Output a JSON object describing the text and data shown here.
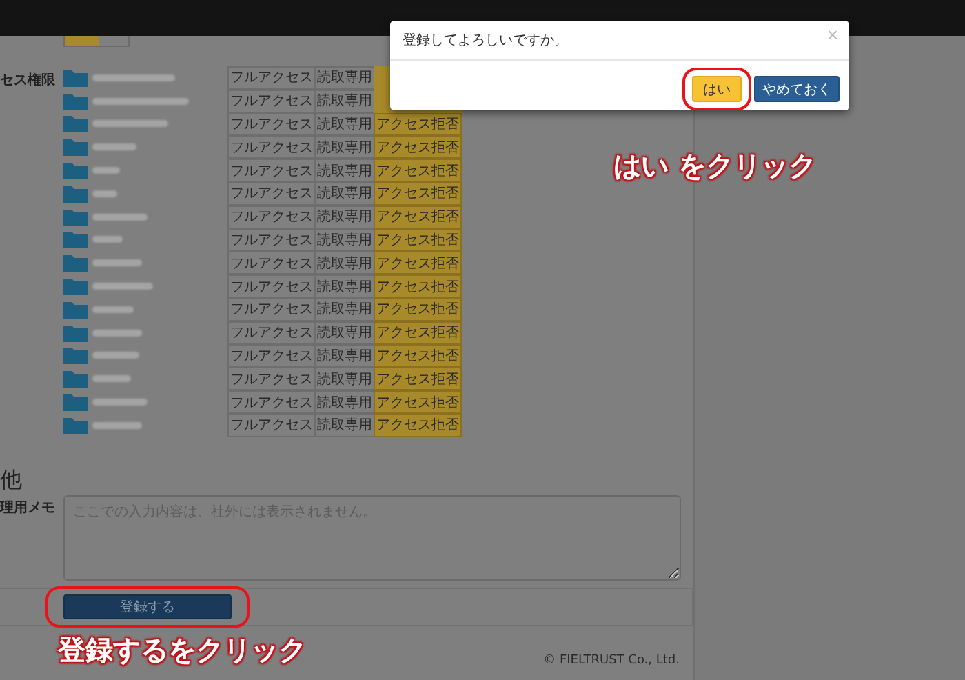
{
  "toggle": {
    "on": true
  },
  "permissions": {
    "label": "セス権限",
    "rows": [
      {
        "options": [
          {
            "label": "フルアクセス",
            "selected": false
          },
          {
            "label": "読取専用",
            "selected": false
          }
        ]
      },
      {
        "options": [
          {
            "label": "フルアクセス",
            "selected": false
          },
          {
            "label": "読取専用",
            "selected": false
          }
        ]
      },
      {
        "options": [
          {
            "label": "フルアクセス",
            "selected": false
          },
          {
            "label": "読取専用",
            "selected": false
          },
          {
            "label": "アクセス拒否",
            "selected": true
          }
        ]
      },
      {
        "options": [
          {
            "label": "フルアクセス",
            "selected": false
          },
          {
            "label": "読取専用",
            "selected": false
          },
          {
            "label": "アクセス拒否",
            "selected": true
          }
        ]
      },
      {
        "options": [
          {
            "label": "フルアクセス",
            "selected": false
          },
          {
            "label": "読取専用",
            "selected": false
          },
          {
            "label": "アクセス拒否",
            "selected": true
          }
        ]
      },
      {
        "options": [
          {
            "label": "フルアクセス",
            "selected": false
          },
          {
            "label": "読取専用",
            "selected": false
          },
          {
            "label": "アクセス拒否",
            "selected": true
          }
        ]
      },
      {
        "options": [
          {
            "label": "フルアクセス",
            "selected": false
          },
          {
            "label": "読取専用",
            "selected": false
          },
          {
            "label": "アクセス拒否",
            "selected": true
          }
        ]
      },
      {
        "options": [
          {
            "label": "フルアクセス",
            "selected": false
          },
          {
            "label": "読取専用",
            "selected": false
          },
          {
            "label": "アクセス拒否",
            "selected": true
          }
        ]
      },
      {
        "options": [
          {
            "label": "フルアクセス",
            "selected": false
          },
          {
            "label": "読取専用",
            "selected": false
          },
          {
            "label": "アクセス拒否",
            "selected": true
          }
        ]
      },
      {
        "options": [
          {
            "label": "フルアクセス",
            "selected": false
          },
          {
            "label": "読取専用",
            "selected": false
          },
          {
            "label": "アクセス拒否",
            "selected": true
          }
        ]
      },
      {
        "options": [
          {
            "label": "フルアクセス",
            "selected": false
          },
          {
            "label": "読取専用",
            "selected": false
          },
          {
            "label": "アクセス拒否",
            "selected": true
          }
        ]
      },
      {
        "options": [
          {
            "label": "フルアクセス",
            "selected": false
          },
          {
            "label": "読取専用",
            "selected": false
          },
          {
            "label": "アクセス拒否",
            "selected": true
          }
        ]
      },
      {
        "options": [
          {
            "label": "フルアクセス",
            "selected": false
          },
          {
            "label": "読取専用",
            "selected": false
          },
          {
            "label": "アクセス拒否",
            "selected": true
          }
        ]
      },
      {
        "options": [
          {
            "label": "フルアクセス",
            "selected": false
          },
          {
            "label": "読取専用",
            "selected": false
          },
          {
            "label": "アクセス拒否",
            "selected": true
          }
        ]
      },
      {
        "options": [
          {
            "label": "フルアクセス",
            "selected": false
          },
          {
            "label": "読取専用",
            "selected": false
          },
          {
            "label": "アクセス拒否",
            "selected": true
          }
        ]
      },
      {
        "options": [
          {
            "label": "フルアクセス",
            "selected": false
          },
          {
            "label": "読取専用",
            "selected": false
          },
          {
            "label": "アクセス拒否",
            "selected": true
          }
        ]
      }
    ]
  },
  "other": {
    "heading": "他",
    "memo_label": "理用メモ",
    "memo_placeholder": "ここでの入力内容は、社外には表示されません。"
  },
  "submit_button": "登録する",
  "footer": "© FIELTRUST Co., Ltd.",
  "dialog": {
    "message": "登録してよろしいですか。",
    "close": "×",
    "buttons": [
      {
        "label": "はい",
        "kind": "primary"
      },
      {
        "label": "やめておく",
        "kind": "secondary"
      }
    ]
  },
  "annotations": [
    {
      "text": "はい をクリック",
      "kind": "dialog"
    },
    {
      "text": "登録するをクリック",
      "kind": "submit"
    }
  ]
}
